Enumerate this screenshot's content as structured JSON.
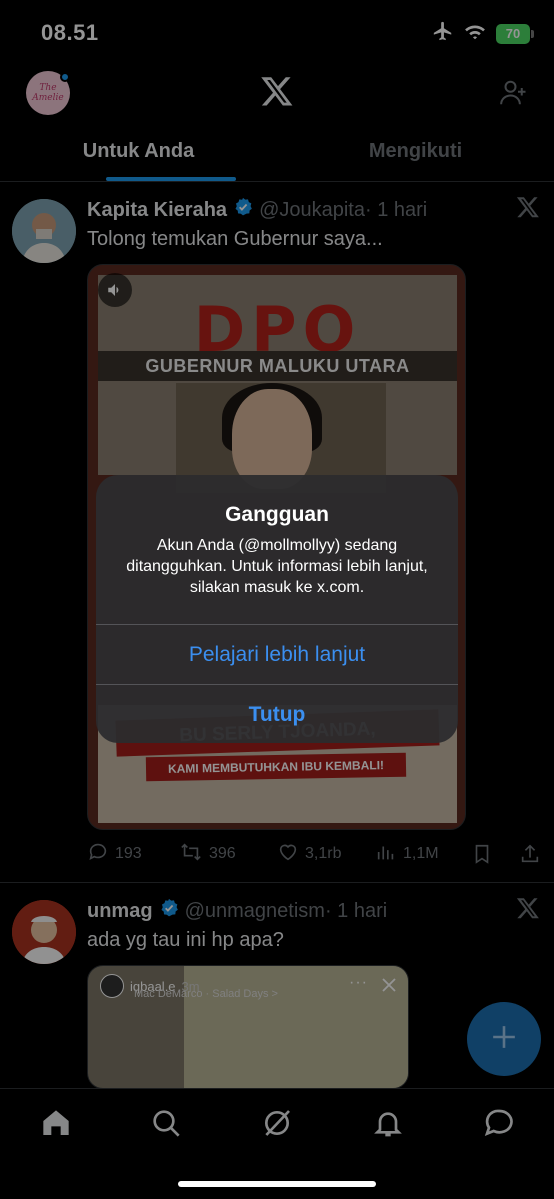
{
  "status_bar": {
    "time": "08.51",
    "battery": "70"
  },
  "header": {
    "avatar_text": "The Amelie"
  },
  "tabs": [
    {
      "label": "Untuk Anda",
      "active": true
    },
    {
      "label": "Mengikuti",
      "active": false
    }
  ],
  "posts": [
    {
      "name": "Kapita Kieraha",
      "handle": "@Joukapita",
      "time": "· 1 hari",
      "text": "Tolong temukan Gubernur saya...",
      "media": {
        "headline": "DPO",
        "subheadline": "GUBERNUR MALUKU UTARA",
        "banner": "BU SERLY TJOANDA, PULANGLAH!",
        "tagline": "KAMI MEMBUTUHKAN IBU KEMBALI!"
      },
      "stats": {
        "replies": "193",
        "reposts": "396",
        "likes": "3,1rb",
        "views": "1,1M"
      }
    },
    {
      "name": "unmag",
      "handle": "@unmagnetism",
      "time": "· 1 hari",
      "text": "ada yg tau ini hp apa?",
      "media": {
        "user": "iqbaal.e",
        "age": "3m",
        "song": "Mac DeMarco · Salad Days >"
      }
    }
  ],
  "alert": {
    "title": "Gangguan",
    "message": "Akun Anda (@mollmollyy) sedang ditangguhkan. Untuk informasi lebih lanjut, silakan masuk ke x.com.",
    "learn_more": "Pelajari lebih lanjut",
    "close": "Tutup"
  },
  "colors": {
    "accent": "#1d9bf0",
    "alert_button": "#3b8ff0",
    "battery": "#4cd964"
  }
}
